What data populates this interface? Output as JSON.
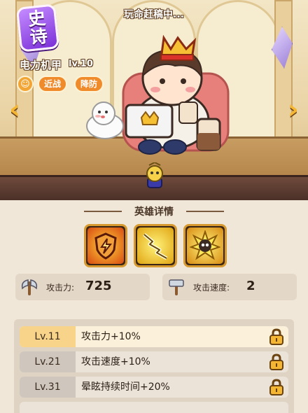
{
  "hero": {
    "rarity": "史诗",
    "name": "电力机甲",
    "level": "lv.10",
    "tags": [
      "近战",
      "降防"
    ],
    "rank_glyph": "☺",
    "status": "玩命赶稿中..."
  },
  "panel": {
    "title": "英雄详情",
    "skills": [
      {
        "icon": "shield-lightning-icon"
      },
      {
        "icon": "lightning-chain-icon"
      },
      {
        "icon": "skull-burst-icon"
      }
    ],
    "stats": [
      {
        "icon": "axe-icon",
        "label": "攻击力:",
        "value": "725"
      },
      {
        "icon": "hammer-icon",
        "label": "攻击速度:",
        "value": "2"
      }
    ],
    "levels": [
      {
        "lv": "Lv.11",
        "desc": "攻击力+10%",
        "active": true
      },
      {
        "lv": "Lv.21",
        "desc": "攻击速度+10%",
        "active": false
      },
      {
        "lv": "Lv.31",
        "desc": "晕眩持续时间+20%",
        "active": false
      }
    ]
  },
  "colors": {
    "rarity_purple": "#8a3ee0",
    "tag_orange": "#f08b2c",
    "frame_gold": "#d69a31",
    "panel_bg": "#f1e7d8"
  }
}
